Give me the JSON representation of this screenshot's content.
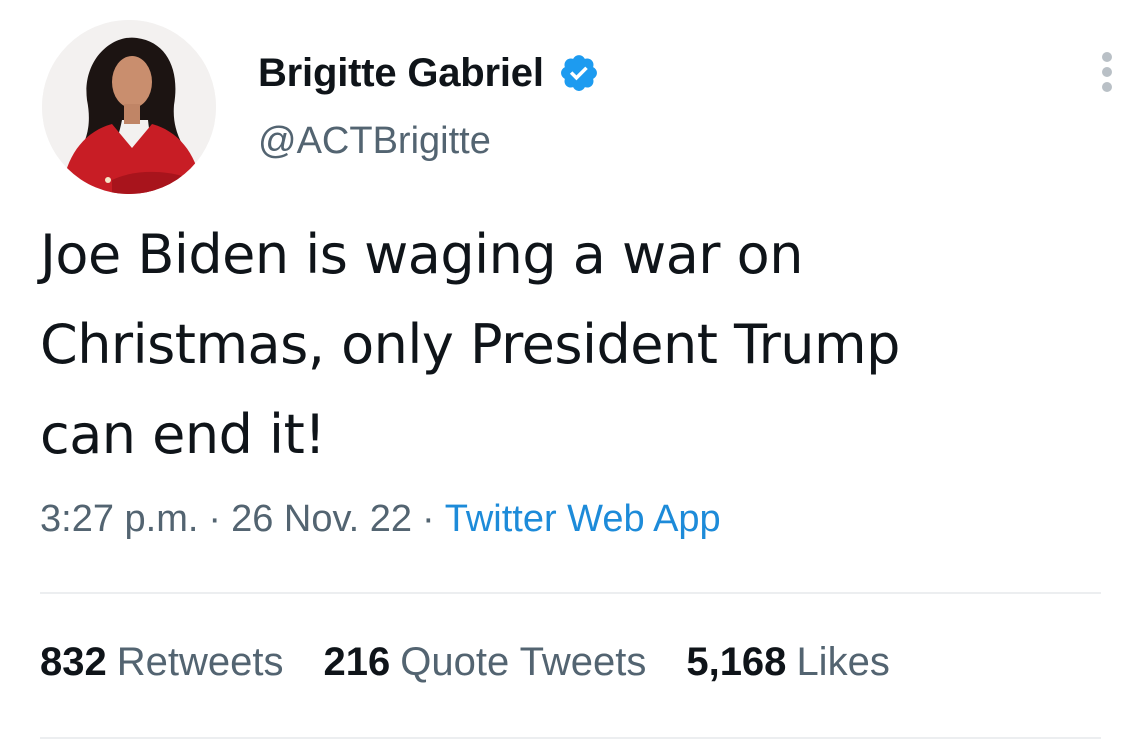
{
  "author": {
    "display_name": "Brigitte Gabriel",
    "handle": "@ACTBrigitte",
    "verified": true,
    "verified_color": "#1d9bf0"
  },
  "tweet": {
    "text": "Joe Biden is waging a war on\nChristmas, only President Trump\ncan end it!",
    "time": "3:27 p.m.",
    "date": "26 Nov. 22",
    "separator": "·",
    "source": "Twitter Web App"
  },
  "stats": {
    "retweets": {
      "count": "832",
      "label": "Retweets"
    },
    "quotes": {
      "count": "216",
      "label": "Quote Tweets"
    },
    "likes": {
      "count": "5,168",
      "label": "Likes"
    }
  },
  "colors": {
    "text": "#0f1419",
    "secondary": "#536471",
    "link": "#1d8bd9",
    "divider": "#eceef0"
  }
}
